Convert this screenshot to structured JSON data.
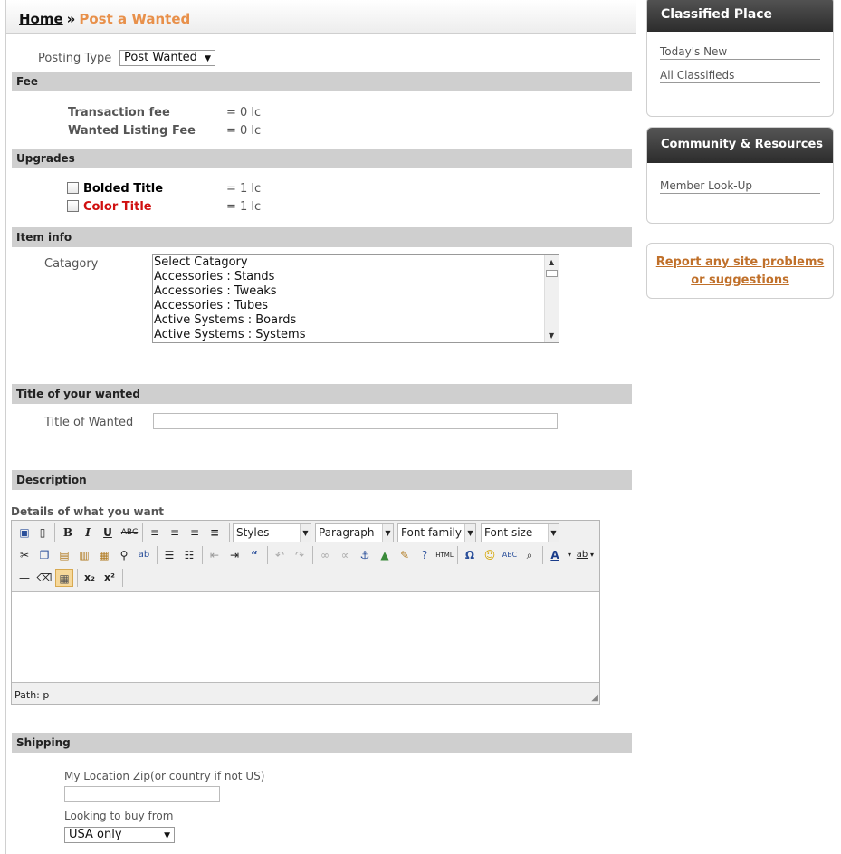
{
  "breadcrumb": {
    "home": "Home",
    "separator": "»",
    "current": "Post a Wanted"
  },
  "posting_type": {
    "label": "Posting Type",
    "value": "Post Wanted"
  },
  "sections": {
    "fee": "Fee",
    "upgrades": "Upgrades",
    "item_info": "Item info",
    "title": "Title of your wanted",
    "description": "Description",
    "shipping": "Shipping"
  },
  "fees": [
    {
      "label": "Transaction fee",
      "value": "= 0 lc"
    },
    {
      "label": "Wanted Listing Fee",
      "value": "= 0 lc"
    }
  ],
  "upgrades": [
    {
      "label": "Bolded Title",
      "value": "= 1 lc",
      "color": "#000000"
    },
    {
      "label": "Color Title",
      "value": "= 1 lc",
      "color": "#d01010"
    }
  ],
  "category": {
    "label": "Catagory",
    "options": [
      "Select Catagory",
      "Accessories : Stands",
      "Accessories : Tweaks",
      "Accessories : Tubes",
      "Active Systems : Boards",
      "Active Systems : Systems"
    ]
  },
  "title_field": {
    "label": "Title of Wanted",
    "value": ""
  },
  "description": {
    "label": "Details of what you want",
    "styles": "Styles",
    "paragraph": "Paragraph",
    "font_family": "Font family",
    "font_size": "Font size",
    "path": "Path: p"
  },
  "shipping": {
    "zip_label": "My Location Zip(or country if not US)",
    "zip_value": "",
    "buy_from_label": "Looking to buy from",
    "buy_from_value": "USA only"
  },
  "sidebar": {
    "classified": {
      "title": "Classified Place",
      "links": [
        "Today's New",
        "All Classifieds"
      ]
    },
    "community": {
      "title": "Community & Resources",
      "links": [
        "Member Look-Up"
      ]
    },
    "report": {
      "line1": "Report any site problems",
      "line2": "or suggestions"
    }
  },
  "colors": {
    "accent": "#e8904a",
    "section_bg": "#cfcfcf",
    "header_dark": "#333333",
    "link_orange": "#c0702a"
  }
}
